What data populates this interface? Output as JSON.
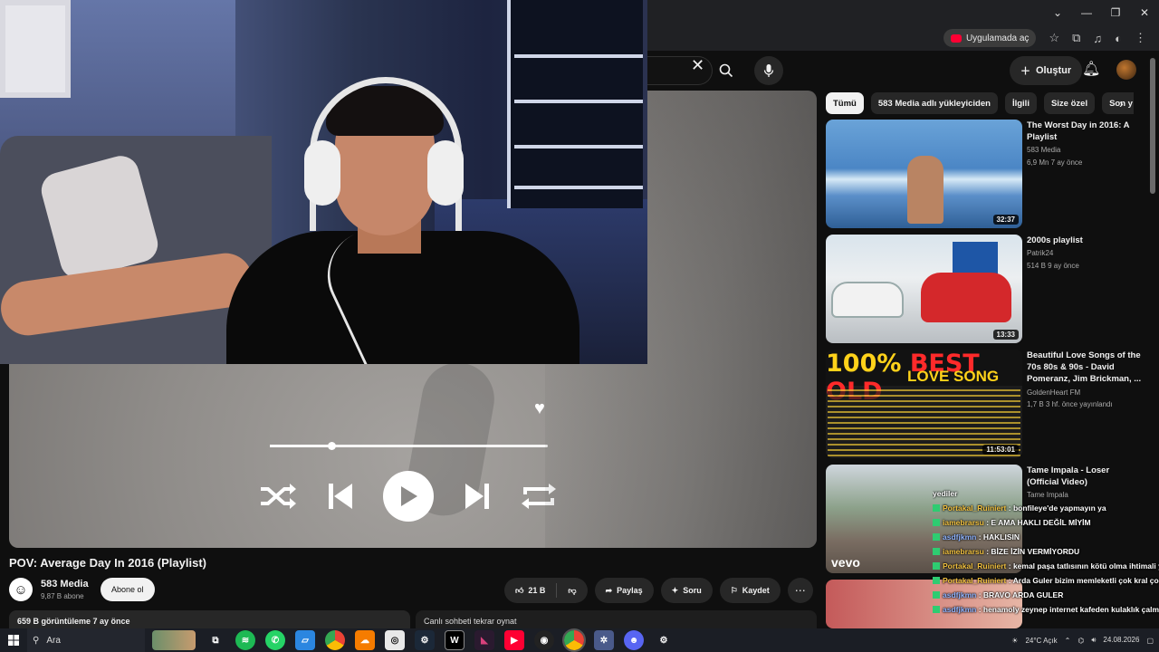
{
  "browser": {
    "open_in_app_label": "Uygulamada aç"
  },
  "header": {
    "create_label": "Oluştur"
  },
  "player": {
    "progress": 0.22
  },
  "video": {
    "title": "POV: Average Day In 2016 (Playlist)",
    "channel": "583 Media",
    "subscribers": "9,87 B abone",
    "subscribe_label": "Abone ol",
    "likes": "21 B",
    "share_label": "Paylaş",
    "ask_label": "Soru",
    "save_label": "Kaydet",
    "views": "659 B görüntüleme  7 ay önce",
    "chat_replay_label": "Canlı sohbeti tekrar oynat"
  },
  "chips": [
    "Tümü",
    "583 Media adlı yükleyiciden",
    "İlgili",
    "Size özel",
    "Son y"
  ],
  "recommendations": [
    {
      "title": "The Worst Day in 2016: A Playlist",
      "channel": "583 Media",
      "meta": "6,9 Mn  7 ay önce",
      "duration": "32:37"
    },
    {
      "title": "2000s playlist",
      "channel": "Patrik24",
      "meta": "514 B  9 ay önce",
      "duration": "13:33"
    },
    {
      "title": "Beautiful Love Songs of the 70s 80s & 90s - David Pomeranz, Jim Brickman, ...",
      "channel": "GoldenHeart FM",
      "meta": "1,7 B  3 hf. önce yayınlandı",
      "duration": "11:53:01"
    },
    {
      "title": "Tame Impala - Loser (Official Video)",
      "channel": "Tame Impala",
      "meta": "",
      "duration": ""
    }
  ],
  "thumb_text": {
    "big1_a": "100%",
    "big1_b": " BEST OLD",
    "big2": "LOVE SONG",
    "vevo": "vevo"
  },
  "chat": [
    {
      "user": "",
      "message": "yediler"
    },
    {
      "user": "Portakal_Ruiniert",
      "message": " : bonfileye'de yapmayın ya"
    },
    {
      "user": "iamebrarsu",
      "message": " : E AMA HAKLI DEĞİL MİYİM"
    },
    {
      "user": "asdfjkmn",
      "message": " : HAKLISIN"
    },
    {
      "user": "iamebrarsu",
      "message": " : BİZE İZİN VERMİYORDU"
    },
    {
      "user": "Portakal_Ruiniert",
      "message": " : kemal paşa tatlısının kötü olma ihtimali yok bu arada ya"
    },
    {
      "user": "Portakal_Ruiniert",
      "message": " : Arda Guler bizim memleketli çok kral çocuk"
    },
    {
      "user": "asdfjkmn",
      "message": " : BRAVO ARDA GULER"
    },
    {
      "user": "asdfjkmn",
      "message": " : henamoly zeynep internet kafeden kulaklık çalmış"
    }
  ],
  "taskbar": {
    "search_label": "Ara",
    "weather": "24°C Açık",
    "date": "24.08.2026"
  },
  "colors": {
    "accent_red": "#ff0033",
    "background": "#0f0f0f",
    "chip_bg": "#272727"
  }
}
